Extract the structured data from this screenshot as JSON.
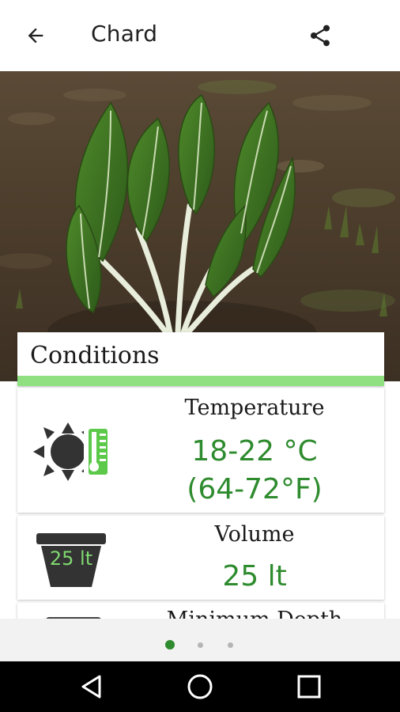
{
  "appbar": {
    "title": "Chard",
    "back_icon": "arrow-back-icon",
    "share_icon": "share-icon"
  },
  "hero": {
    "image": "chard-plant-photo"
  },
  "conditions": {
    "title": "Conditions",
    "accent_color": "#90e082",
    "items": [
      {
        "label": "Temperature",
        "value_line1": "18-22 °C",
        "value_line2": "(64-72°F)",
        "icon": "sun-thermometer-icon"
      },
      {
        "label": "Volume",
        "value_line1": "25 lt",
        "icon": "pot-icon",
        "icon_text": "25 lt"
      },
      {
        "label": "Minimum Depth"
      }
    ],
    "value_color": "#2e8b2e"
  },
  "pager": {
    "count": 3,
    "active_index": 0,
    "active_color": "#2e8b2e"
  },
  "navbar": {
    "back_icon": "nav-back-icon",
    "home_icon": "nav-home-icon",
    "recents_icon": "nav-recents-icon"
  }
}
